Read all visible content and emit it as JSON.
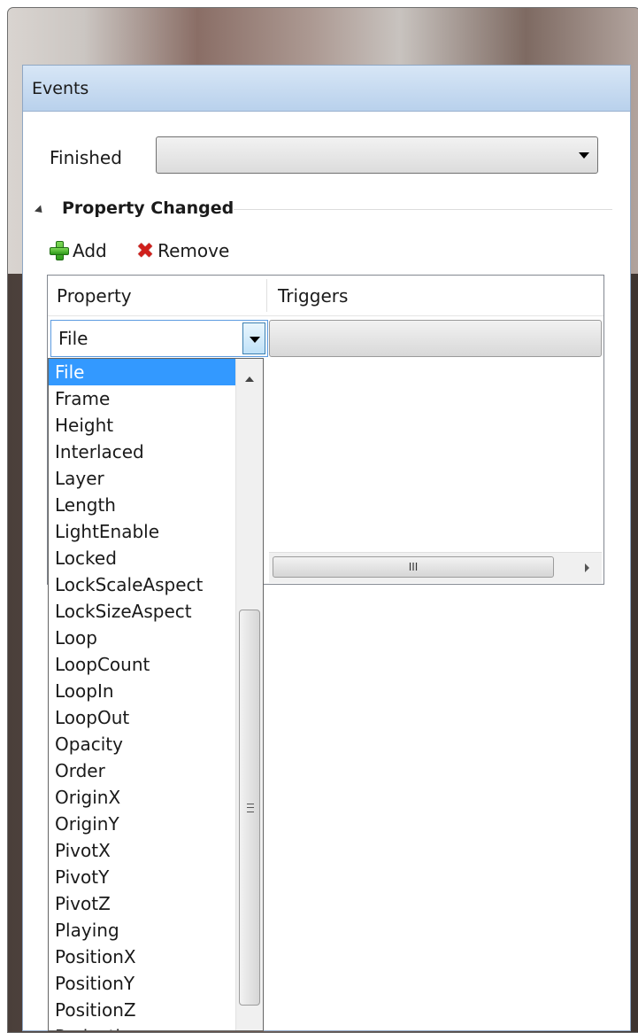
{
  "panel": {
    "title": "Events"
  },
  "events": {
    "finished_label": "Finished",
    "finished_value": ""
  },
  "section": {
    "title": "Property Changed",
    "expanded": true
  },
  "toolbar": {
    "add_label": "Add",
    "remove_label": "Remove",
    "add_icon": "plus-icon",
    "remove_icon": "x-icon"
  },
  "grid": {
    "columns": [
      "Property",
      "Triggers"
    ],
    "row": {
      "property": "File",
      "triggers": ""
    }
  },
  "hscrollbar": {
    "thumb_text": "III"
  },
  "dropdown": {
    "selected": "File",
    "items": [
      "File",
      "Frame",
      "Height",
      "Interlaced",
      "Layer",
      "Length",
      "LightEnable",
      "Locked",
      "LockScaleAspect",
      "LockSizeAspect",
      "Loop",
      "LoopCount",
      "LoopIn",
      "LoopOut",
      "Opacity",
      "Order",
      "OriginX",
      "OriginY",
      "PivotX",
      "PivotY",
      "PivotZ",
      "Playing",
      "PositionX",
      "PositionY",
      "PositionZ",
      "Projection"
    ],
    "selection_color": "#3399ff"
  }
}
